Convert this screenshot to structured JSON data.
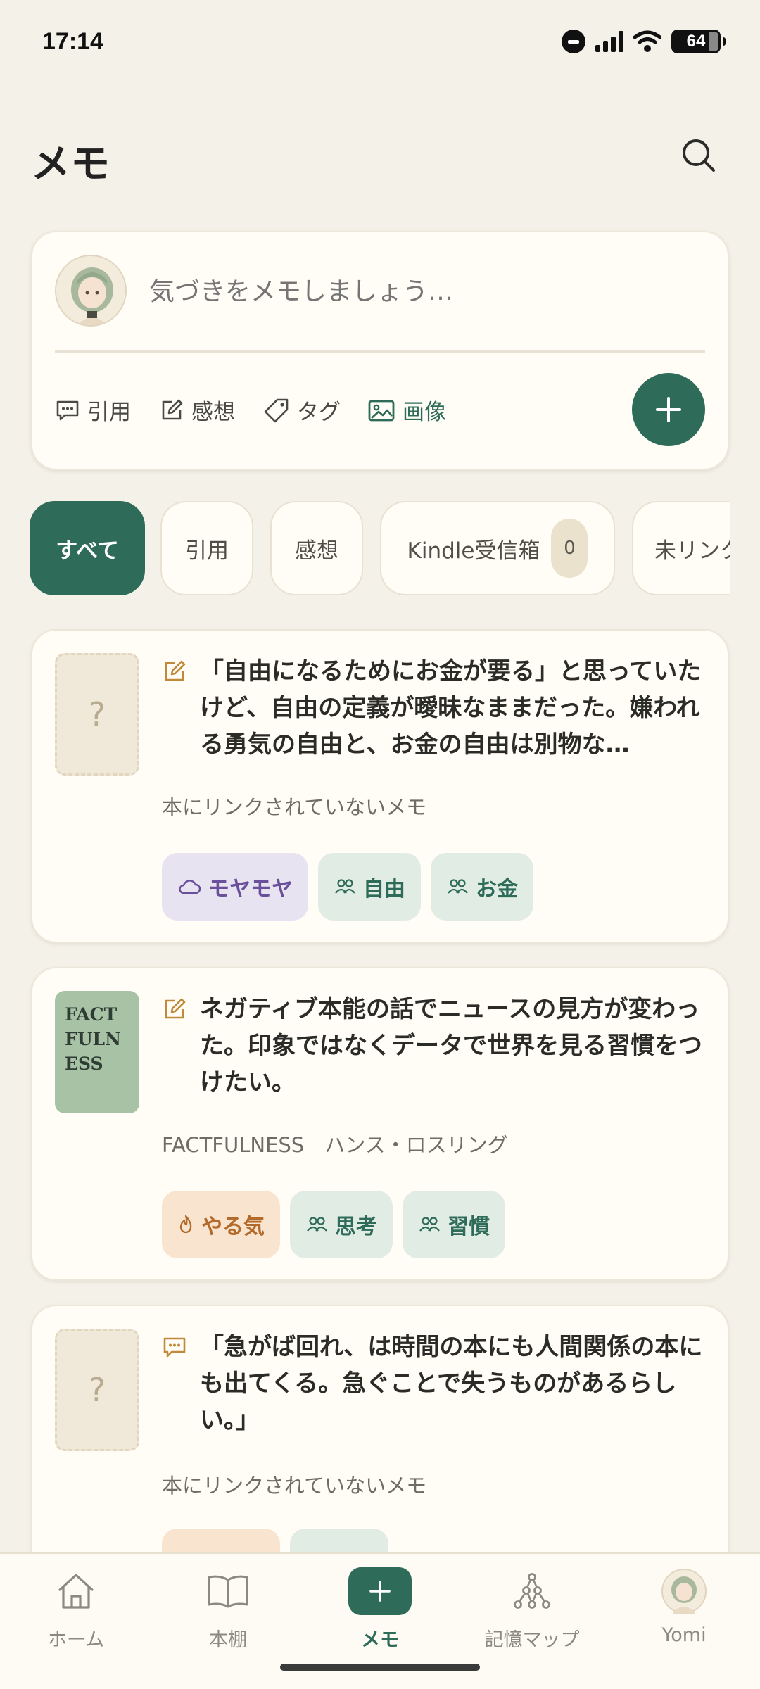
{
  "status_bar": {
    "time": "17:14",
    "battery": "64"
  },
  "header": {
    "title": "メモ"
  },
  "composer": {
    "placeholder": "気づきをメモしましょう…",
    "tools": [
      {
        "label": "引用",
        "icon": "quote-icon"
      },
      {
        "label": "感想",
        "icon": "edit-icon"
      },
      {
        "label": "タグ",
        "icon": "tag-icon"
      },
      {
        "label": "画像",
        "icon": "image-icon"
      }
    ]
  },
  "filters": [
    {
      "label": "すべて",
      "active": true
    },
    {
      "label": "引用"
    },
    {
      "label": "感想"
    },
    {
      "label": "Kindle受信箱",
      "count": "0"
    },
    {
      "label": "未リンク"
    }
  ],
  "memos": [
    {
      "type": "thought",
      "cover_placeholder": "?",
      "text": "「自由になるためにお金が要る」と思っていたけど、自由の定義が曖昧なままだった。嫌われる勇気の自由と、お金の自由は別物な…",
      "source": "本にリンクされていないメモ",
      "tags": [
        {
          "label": "モヤモヤ",
          "icon": "cloud-icon",
          "color": "purple"
        },
        {
          "label": "自由",
          "icon": "people-icon",
          "color": "green"
        },
        {
          "label": "お金",
          "icon": "people-icon",
          "color": "green"
        }
      ]
    },
    {
      "type": "thought",
      "cover_text": "FACT FULN ESS",
      "text": "ネガティブ本能の話でニュースの見方が変わった。印象ではなくデータで世界を見る習慣をつけたい。",
      "source": "FACTFULNESS　ハンス・ロスリング",
      "tags": [
        {
          "label": "やる気",
          "icon": "flame-icon",
          "color": "orange"
        },
        {
          "label": "思考",
          "icon": "people-icon",
          "color": "green"
        },
        {
          "label": "習慣",
          "icon": "people-icon",
          "color": "green"
        }
      ]
    },
    {
      "type": "quote",
      "cover_placeholder": "?",
      "text": "「急がば回れ、は時間の本にも人間関係の本にも出てくる。急ぐことで失うものがあるらしい。」",
      "source": "本にリンクされていないメモ"
    }
  ],
  "bottom_nav": [
    {
      "label": "ホーム"
    },
    {
      "label": "本棚"
    },
    {
      "label": "メモ",
      "active": true
    },
    {
      "label": "記憶マップ"
    },
    {
      "label": "Yomi"
    }
  ],
  "colors": {
    "accent": "#2e6b59",
    "background": "#f4f1e8",
    "card": "#fffdf6"
  }
}
